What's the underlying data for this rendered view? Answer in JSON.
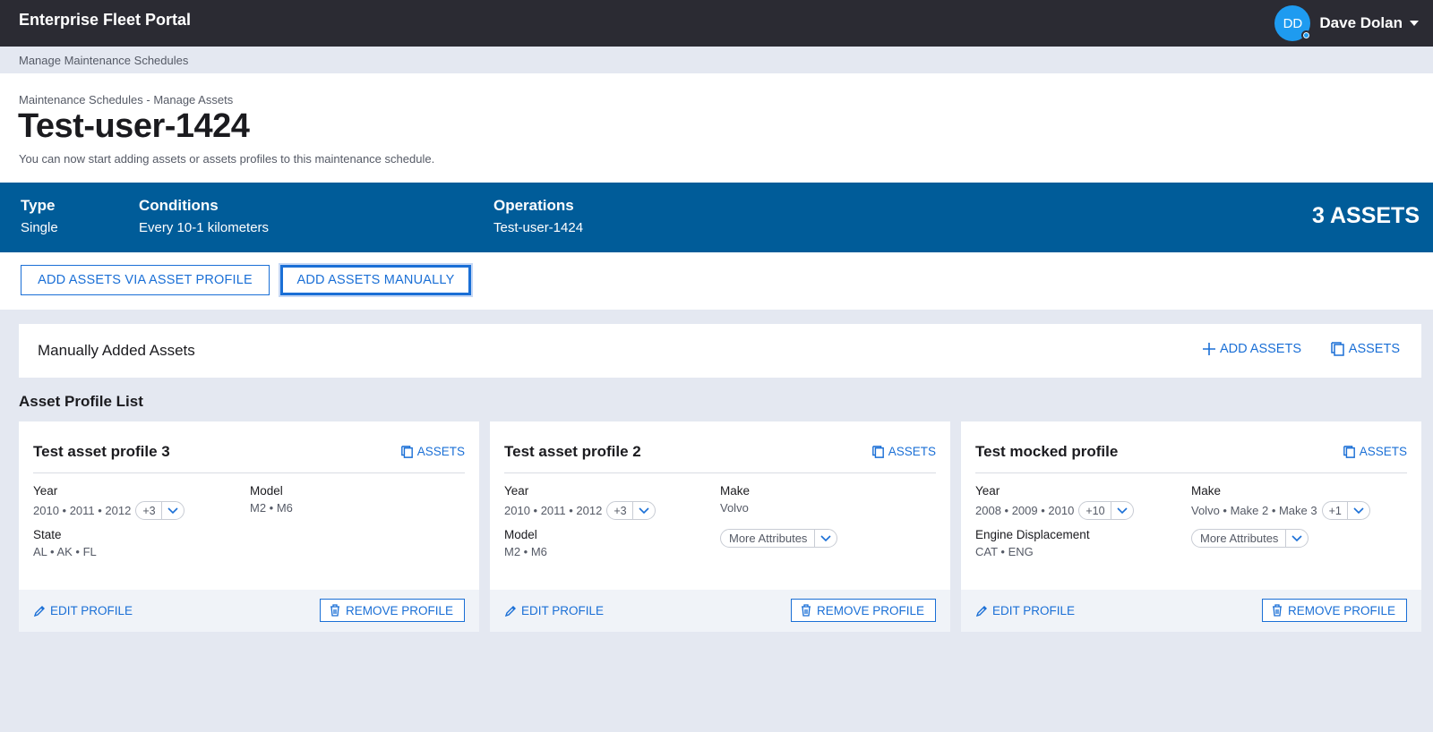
{
  "app": {
    "title": "Enterprise Fleet Portal"
  },
  "user": {
    "initials": "DD",
    "name": "Dave Dolan"
  },
  "breadcrumb": "Manage Maintenance Schedules",
  "header": {
    "subtitle": "Maintenance Schedules - Manage Assets",
    "title": "Test-user-1424",
    "description": "You can now start adding assets or assets profiles to this maintenance schedule."
  },
  "summary": {
    "type_label": "Type",
    "type_value": "Single",
    "conditions_label": "Conditions",
    "conditions_value": "Every 10-1 kilometers",
    "operations_label": "Operations",
    "operations_value": "Test-user-1424",
    "asset_count": "3 ASSETS"
  },
  "actions": {
    "via_profile": "ADD ASSETS VIA ASSET PROFILE",
    "manually": "ADD ASSETS MANUALLY"
  },
  "manual": {
    "title": "Manually Added Assets",
    "add_assets": "ADD ASSETS",
    "assets": "ASSETS"
  },
  "profile_list_title": "Asset Profile List",
  "colors": {
    "accent": "#1a6fd6",
    "banner": "#005c99",
    "topbar": "#2b2b33",
    "avatar": "#1e9bf0"
  },
  "profiles": [
    {
      "title": "Test asset profile 3",
      "assets_link": "ASSETS",
      "attr1_label": "Year",
      "attr1_value": "2010 • 2011 • 2012",
      "attr1_more": "+3",
      "attr2_label": "Model",
      "attr2_value": "M2 • M6",
      "attr3_label": "State",
      "attr3_value": "AL • AK • FL",
      "edit": "EDIT PROFILE",
      "remove": "REMOVE PROFILE"
    },
    {
      "title": "Test asset profile 2",
      "assets_link": "ASSETS",
      "attr1_label": "Year",
      "attr1_value": "2010 • 2011 • 2012",
      "attr1_more": "+3",
      "attr2_label": "Make",
      "attr2_value": "Volvo",
      "attr3_label": "Model",
      "attr3_value": "M2 • M6",
      "more_attributes": "More Attributes",
      "edit": "EDIT PROFILE",
      "remove": "REMOVE PROFILE"
    },
    {
      "title": "Test mocked profile",
      "assets_link": "ASSETS",
      "attr1_label": "Year",
      "attr1_value": "2008 • 2009 • 2010",
      "attr1_more": "+10",
      "attr2_label": "Make",
      "attr2_value": "Volvo • Make 2 • Make 3",
      "attr2_more": "+1",
      "attr3_label": "Engine Displacement",
      "attr3_value": "CAT • ENG",
      "more_attributes": "More Attributes",
      "edit": "EDIT PROFILE",
      "remove": "REMOVE PROFILE"
    }
  ]
}
